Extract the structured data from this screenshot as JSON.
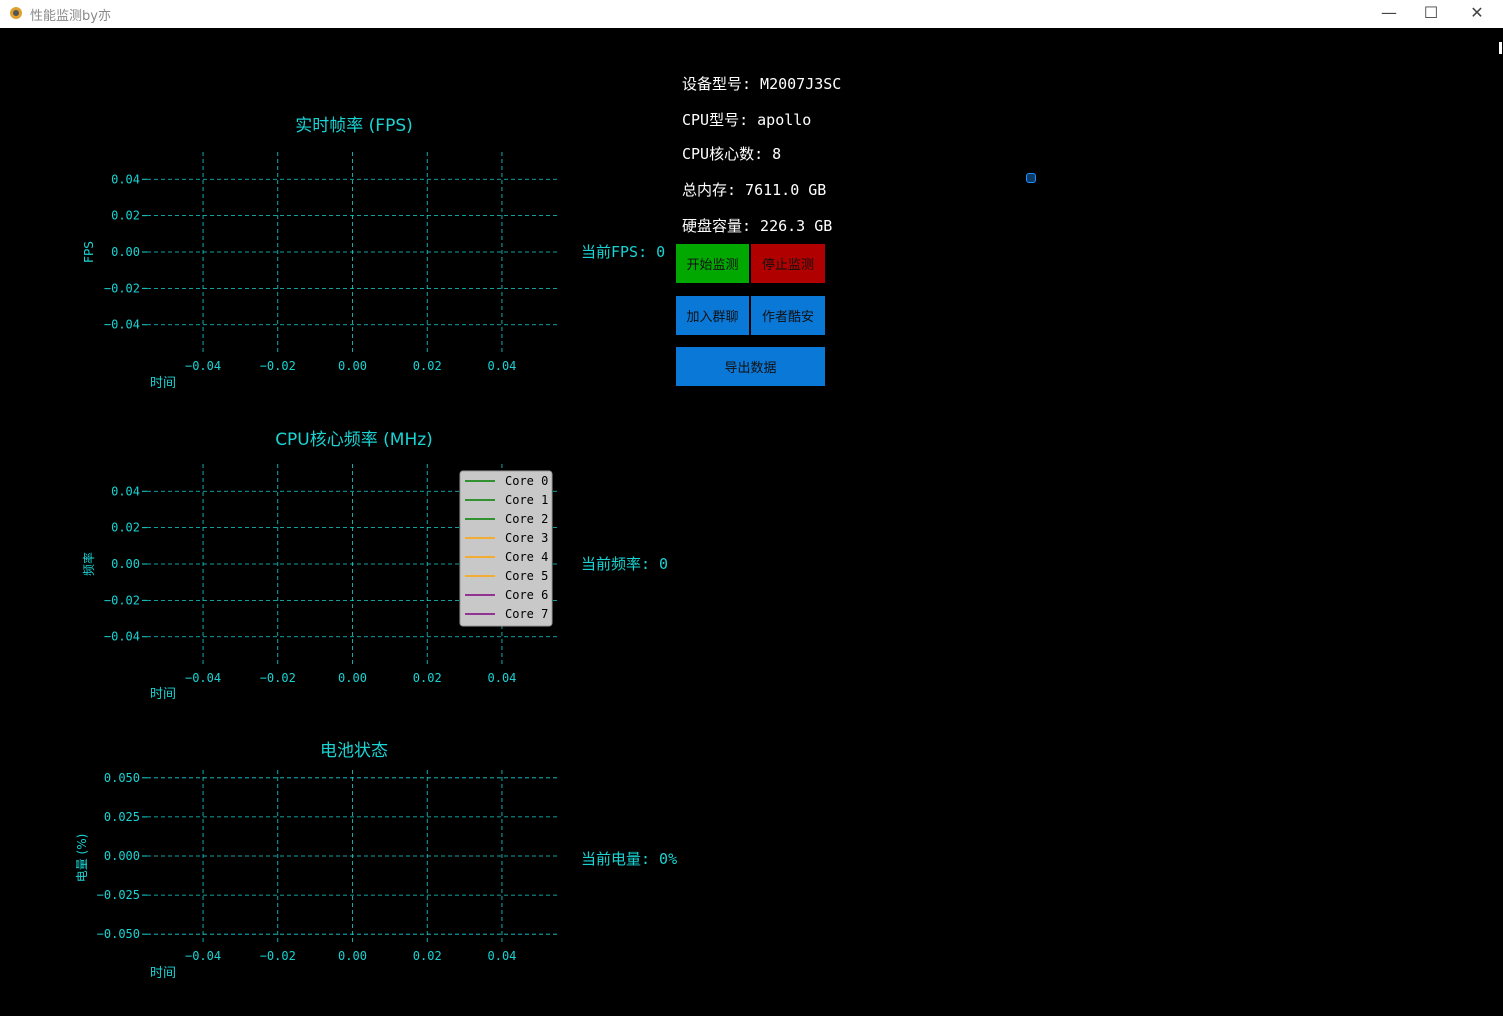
{
  "window": {
    "title": "性能监测by亦",
    "minimize": "—",
    "maximize": "☐",
    "close": "✕"
  },
  "charts": [
    {
      "title": "实时帧率 (FPS)",
      "ylabel": "FPS",
      "xlabel": "时间",
      "xticks": [
        "−0.04",
        "−0.02",
        "0.00",
        "0.02",
        "0.04"
      ],
      "yticks": [
        "0.04",
        "0.02",
        "0.00",
        "−0.02",
        "−0.04"
      ]
    },
    {
      "title": "CPU核心频率 (MHz)",
      "ylabel": "频率",
      "xlabel": "时间",
      "xticks": [
        "−0.04",
        "−0.02",
        "0.00",
        "0.02",
        "0.04"
      ],
      "yticks": [
        "0.04",
        "0.02",
        "0.00",
        "−0.02",
        "−0.04"
      ],
      "legend": [
        {
          "name": "Core 0",
          "color": "#008000"
        },
        {
          "name": "Core 1",
          "color": "#008000"
        },
        {
          "name": "Core 2",
          "color": "#008000"
        },
        {
          "name": "Core 3",
          "color": "#ffa500"
        },
        {
          "name": "Core 4",
          "color": "#ffa500"
        },
        {
          "name": "Core 5",
          "color": "#ffa500"
        },
        {
          "name": "Core 6",
          "color": "#800080"
        },
        {
          "name": "Core 7",
          "color": "#800080"
        }
      ]
    },
    {
      "title": "电池状态",
      "ylabel": "电量 (%)",
      "xlabel": "时间",
      "xticks": [
        "−0.04",
        "−0.02",
        "0.00",
        "0.02",
        "0.04"
      ],
      "yticks": [
        "0.050",
        "0.025",
        "0.000",
        "−0.025",
        "−0.050"
      ]
    }
  ],
  "chart_data": [
    {
      "type": "line",
      "title": "实时帧率 (FPS)",
      "xlabel": "时间",
      "ylabel": "FPS",
      "xlim": [
        -0.055,
        0.055
      ],
      "ylim": [
        -0.055,
        0.055
      ],
      "grid": true,
      "series": []
    },
    {
      "type": "line",
      "title": "CPU核心频率 (MHz)",
      "xlabel": "时间",
      "ylabel": "频率",
      "xlim": [
        -0.055,
        0.055
      ],
      "ylim": [
        -0.055,
        0.055
      ],
      "grid": true,
      "legend_position": "top-right",
      "series": [
        {
          "name": "Core 0",
          "values": []
        },
        {
          "name": "Core 1",
          "values": []
        },
        {
          "name": "Core 2",
          "values": []
        },
        {
          "name": "Core 3",
          "values": []
        },
        {
          "name": "Core 4",
          "values": []
        },
        {
          "name": "Core 5",
          "values": []
        },
        {
          "name": "Core 6",
          "values": []
        },
        {
          "name": "Core 7",
          "values": []
        }
      ]
    },
    {
      "type": "line",
      "title": "电池状态",
      "xlabel": "时间",
      "ylabel": "电量 (%)",
      "xlim": [
        -0.055,
        0.055
      ],
      "ylim": [
        -0.055,
        0.055
      ],
      "grid": true,
      "series": []
    }
  ],
  "current": {
    "fps": "当前FPS: 0",
    "freq": "当前频率: 0",
    "battery": "当前电量: 0%"
  },
  "device": {
    "model": "设备型号: M2007J3SC",
    "cpu_model": "CPU型号: apollo",
    "cpu_cores": "CPU核心数: 8",
    "memory": "总内存: 7611.0 GB",
    "disk": "硬盘容量: 226.3 GB"
  },
  "buttons": {
    "start": "开始监测",
    "stop": "停止监测",
    "join": "加入群聊",
    "author": "作者酷安",
    "export": "导出数据"
  },
  "colors": {
    "accent": "#1ad3d3",
    "start": "#00a800",
    "stop": "#b00000",
    "blue": "#0a78d7"
  }
}
